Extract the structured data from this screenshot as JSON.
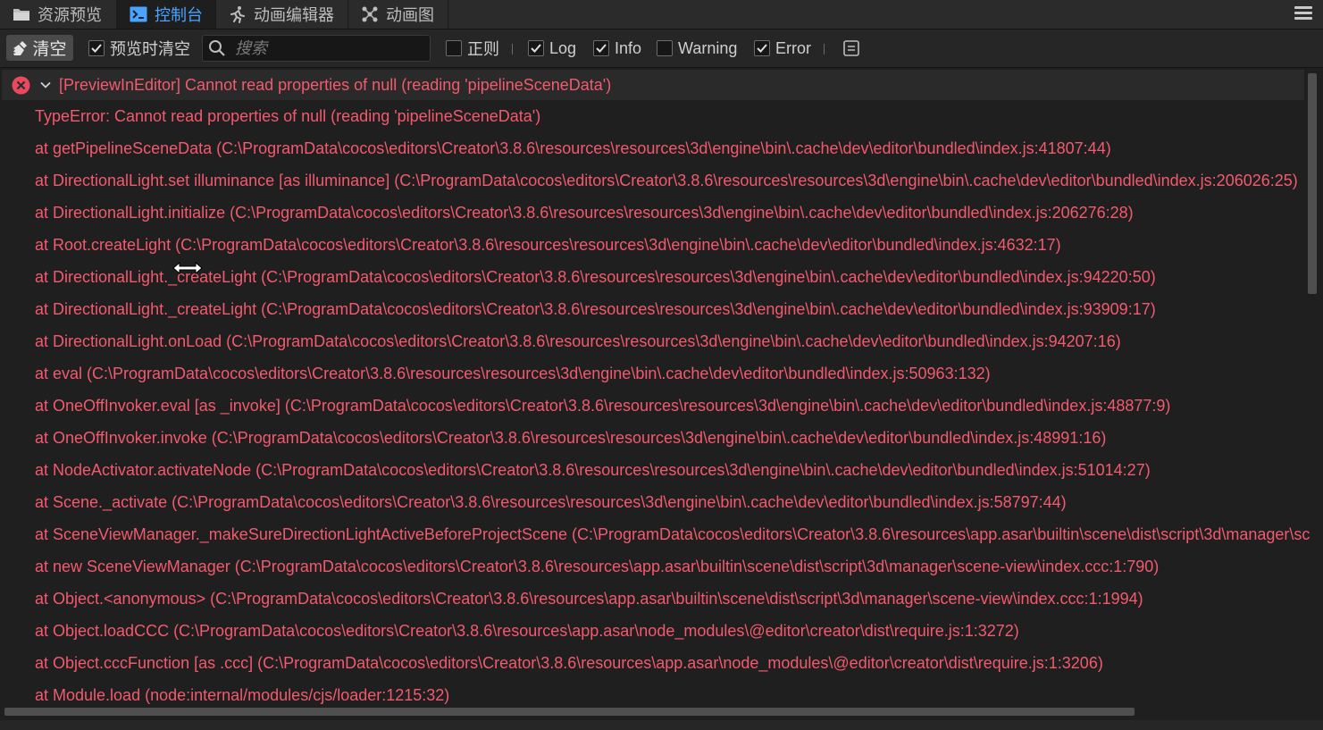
{
  "tabs": [
    {
      "label": "资源预览",
      "icon": "folder-icon"
    },
    {
      "label": "控制台",
      "icon": "terminal-icon",
      "active": true
    },
    {
      "label": "动画编辑器",
      "icon": "running-man-icon"
    },
    {
      "label": "动画图",
      "icon": "graph-icon"
    }
  ],
  "toolbar": {
    "clear_label": "清空",
    "preview_clear_label": "预览时清空",
    "preview_clear_checked": true,
    "search_placeholder": "搜索",
    "regex_label": "正则",
    "regex_checked": false,
    "log_label": "Log",
    "log_checked": true,
    "info_label": "Info",
    "info_checked": true,
    "warning_label": "Warning",
    "warning_checked": false,
    "error_label": "Error",
    "error_checked": true
  },
  "colors": {
    "accent": "#4aa3ff",
    "error_text": "#f25a6e",
    "error_icon": "#e8495f"
  },
  "log": {
    "header": "[PreviewInEditor] Cannot read properties of null (reading 'pipelineSceneData')",
    "lines": [
      "TypeError: Cannot read properties of null (reading 'pipelineSceneData')",
      "at getPipelineSceneData (C:\\ProgramData\\cocos\\editors\\Creator\\3.8.6\\resources\\resources\\3d\\engine\\bin\\.cache\\dev\\editor\\bundled\\index.js:41807:44)",
      "at DirectionalLight.set illuminance [as illuminance] (C:\\ProgramData\\cocos\\editors\\Creator\\3.8.6\\resources\\resources\\3d\\engine\\bin\\.cache\\dev\\editor\\bundled\\index.js:206026:25)",
      "at DirectionalLight.initialize (C:\\ProgramData\\cocos\\editors\\Creator\\3.8.6\\resources\\resources\\3d\\engine\\bin\\.cache\\dev\\editor\\bundled\\index.js:206276:28)",
      "at Root.createLight (C:\\ProgramData\\cocos\\editors\\Creator\\3.8.6\\resources\\resources\\3d\\engine\\bin\\.cache\\dev\\editor\\bundled\\index.js:4632:17)",
      "at DirectionalLight._createLight (C:\\ProgramData\\cocos\\editors\\Creator\\3.8.6\\resources\\resources\\3d\\engine\\bin\\.cache\\dev\\editor\\bundled\\index.js:94220:50)",
      "at DirectionalLight._createLight (C:\\ProgramData\\cocos\\editors\\Creator\\3.8.6\\resources\\resources\\3d\\engine\\bin\\.cache\\dev\\editor\\bundled\\index.js:93909:17)",
      "at DirectionalLight.onLoad (C:\\ProgramData\\cocos\\editors\\Creator\\3.8.6\\resources\\resources\\3d\\engine\\bin\\.cache\\dev\\editor\\bundled\\index.js:94207:16)",
      "at eval (C:\\ProgramData\\cocos\\editors\\Creator\\3.8.6\\resources\\resources\\3d\\engine\\bin\\.cache\\dev\\editor\\bundled\\index.js:50963:132)",
      "at OneOffInvoker.eval [as _invoke] (C:\\ProgramData\\cocos\\editors\\Creator\\3.8.6\\resources\\resources\\3d\\engine\\bin\\.cache\\dev\\editor\\bundled\\index.js:48877:9)",
      "at OneOffInvoker.invoke (C:\\ProgramData\\cocos\\editors\\Creator\\3.8.6\\resources\\resources\\3d\\engine\\bin\\.cache\\dev\\editor\\bundled\\index.js:48991:16)",
      "at NodeActivator.activateNode (C:\\ProgramData\\cocos\\editors\\Creator\\3.8.6\\resources\\resources\\3d\\engine\\bin\\.cache\\dev\\editor\\bundled\\index.js:51014:27)",
      "at Scene._activate (C:\\ProgramData\\cocos\\editors\\Creator\\3.8.6\\resources\\resources\\3d\\engine\\bin\\.cache\\dev\\editor\\bundled\\index.js:58797:44)",
      "at SceneViewManager._makeSureDirectionLightActiveBeforeProjectScene (C:\\ProgramData\\cocos\\editors\\Creator\\3.8.6\\resources\\app.asar\\builtin\\scene\\dist\\script\\3d\\manager\\sc",
      "at new SceneViewManager (C:\\ProgramData\\cocos\\editors\\Creator\\3.8.6\\resources\\app.asar\\builtin\\scene\\dist\\script\\3d\\manager\\scene-view\\index.ccc:1:790)",
      "at Object.<anonymous> (C:\\ProgramData\\cocos\\editors\\Creator\\3.8.6\\resources\\app.asar\\builtin\\scene\\dist\\script\\3d\\manager\\scene-view\\index.ccc:1:1994)",
      "at Object.loadCCC (C:\\ProgramData\\cocos\\editors\\Creator\\3.8.6\\resources\\app.asar\\node_modules\\@editor\\creator\\dist\\require.js:1:3272)",
      "at Object.cccFunction [as .ccc] (C:\\ProgramData\\cocos\\editors\\Creator\\3.8.6\\resources\\app.asar\\node_modules\\@editor\\creator\\dist\\require.js:1:3206)",
      "at Module.load (node:internal/modules/cjs/loader:1215:32)"
    ]
  }
}
